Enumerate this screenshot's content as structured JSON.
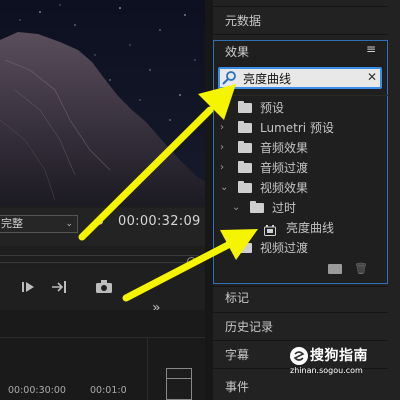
{
  "program_monitor": {
    "fit_value": "完整",
    "timecode": "00:00:32:09"
  },
  "timeline": {
    "ruler_times": [
      "00:00:30:00",
      "00:01:0"
    ]
  },
  "panels": {
    "metadata_title": "元数据",
    "effects_title": "效果",
    "markers_title": "标记",
    "history_title": "历史记录",
    "captions_title": "字幕",
    "events_title": "事件"
  },
  "effects": {
    "search_value": "亮度曲线",
    "tree": [
      {
        "label": "预设",
        "expanded": false,
        "level": 0,
        "kind": "preset-folder"
      },
      {
        "label": "Lumetri 预设",
        "expanded": false,
        "level": 0,
        "kind": "preset-folder"
      },
      {
        "label": "音频效果",
        "expanded": false,
        "level": 0,
        "kind": "folder"
      },
      {
        "label": "音频过渡",
        "expanded": false,
        "level": 0,
        "kind": "folder"
      },
      {
        "label": "视频效果",
        "expanded": true,
        "level": 0,
        "kind": "folder"
      },
      {
        "label": "过时",
        "expanded": true,
        "level": 1,
        "kind": "folder"
      },
      {
        "label": "亮度曲线",
        "level": 2,
        "kind": "effect"
      },
      {
        "label": "视频过渡",
        "expanded": false,
        "level": 0,
        "kind": "folder"
      }
    ]
  },
  "watermark": {
    "text": "搜狗指南",
    "url": "zhinan.sogou.com"
  },
  "colors": {
    "annotation_arrow": "#f5f500",
    "focus_border": "#2f6fb4",
    "search_border": "#3a8ee6"
  }
}
